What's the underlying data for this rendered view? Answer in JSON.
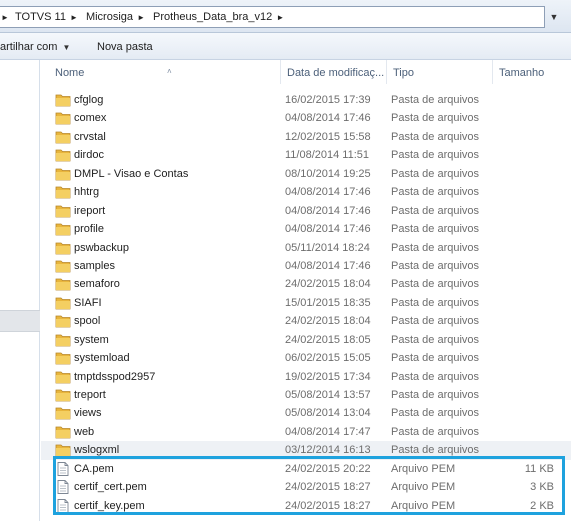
{
  "breadcrumb": [
    "TOTVS 11",
    "Microsiga",
    "Protheus_Data_bra_v12"
  ],
  "toolbar": {
    "share_label": "artilhar com",
    "new_folder_label": "Nova pasta"
  },
  "columns": {
    "name": "Nome",
    "date": "Data de modificaç...",
    "type": "Tipo",
    "size": "Tamanho"
  },
  "files": [
    {
      "name": "cfglog",
      "date": "16/02/2015 17:39",
      "type": "Pasta de arquivos",
      "size": "",
      "kind": "folder"
    },
    {
      "name": "comex",
      "date": "04/08/2014 17:46",
      "type": "Pasta de arquivos",
      "size": "",
      "kind": "folder"
    },
    {
      "name": "crvstal",
      "date": "12/02/2015 15:58",
      "type": "Pasta de arquivos",
      "size": "",
      "kind": "folder"
    },
    {
      "name": "dirdoc",
      "date": "11/08/2014 11:51",
      "type": "Pasta de arquivos",
      "size": "",
      "kind": "folder"
    },
    {
      "name": "DMPL - Visao e Contas",
      "date": "08/10/2014 19:25",
      "type": "Pasta de arquivos",
      "size": "",
      "kind": "folder"
    },
    {
      "name": "hhtrg",
      "date": "04/08/2014 17:46",
      "type": "Pasta de arquivos",
      "size": "",
      "kind": "folder"
    },
    {
      "name": "ireport",
      "date": "04/08/2014 17:46",
      "type": "Pasta de arquivos",
      "size": "",
      "kind": "folder"
    },
    {
      "name": "profile",
      "date": "04/08/2014 17:46",
      "type": "Pasta de arquivos",
      "size": "",
      "kind": "folder"
    },
    {
      "name": "pswbackup",
      "date": "05/11/2014 18:24",
      "type": "Pasta de arquivos",
      "size": "",
      "kind": "folder"
    },
    {
      "name": "samples",
      "date": "04/08/2014 17:46",
      "type": "Pasta de arquivos",
      "size": "",
      "kind": "folder"
    },
    {
      "name": "semaforo",
      "date": "24/02/2015 18:04",
      "type": "Pasta de arquivos",
      "size": "",
      "kind": "folder"
    },
    {
      "name": "SIAFI",
      "date": "15/01/2015 18:35",
      "type": "Pasta de arquivos",
      "size": "",
      "kind": "folder"
    },
    {
      "name": "spool",
      "date": "24/02/2015 18:04",
      "type": "Pasta de arquivos",
      "size": "",
      "kind": "folder"
    },
    {
      "name": "system",
      "date": "24/02/2015 18:05",
      "type": "Pasta de arquivos",
      "size": "",
      "kind": "folder"
    },
    {
      "name": "systemload",
      "date": "06/02/2015 15:05",
      "type": "Pasta de arquivos",
      "size": "",
      "kind": "folder"
    },
    {
      "name": "tmptdsspod2957",
      "date": "19/02/2015 17:34",
      "type": "Pasta de arquivos",
      "size": "",
      "kind": "folder"
    },
    {
      "name": "treport",
      "date": "05/08/2014 13:57",
      "type": "Pasta de arquivos",
      "size": "",
      "kind": "folder"
    },
    {
      "name": "views",
      "date": "05/08/2014 13:04",
      "type": "Pasta de arquivos",
      "size": "",
      "kind": "folder"
    },
    {
      "name": "web",
      "date": "04/08/2014 17:47",
      "type": "Pasta de arquivos",
      "size": "",
      "kind": "folder"
    },
    {
      "name": "wslogxml",
      "date": "03/12/2014 16:13",
      "type": "Pasta de arquivos",
      "size": "",
      "kind": "folder"
    },
    {
      "name": "CA.pem",
      "date": "24/02/2015 20:22",
      "type": "Arquivo PEM",
      "size": "11 KB",
      "kind": "file"
    },
    {
      "name": "certif_cert.pem",
      "date": "24/02/2015 18:27",
      "type": "Arquivo PEM",
      "size": "3 KB",
      "kind": "file"
    },
    {
      "name": "certif_key.pem",
      "date": "24/02/2015 18:27",
      "type": "Arquivo PEM",
      "size": "2 KB",
      "kind": "file"
    }
  ],
  "selected_index": 19,
  "highlight_color": "#1ea2de",
  "folder_color": "#e8b53c"
}
